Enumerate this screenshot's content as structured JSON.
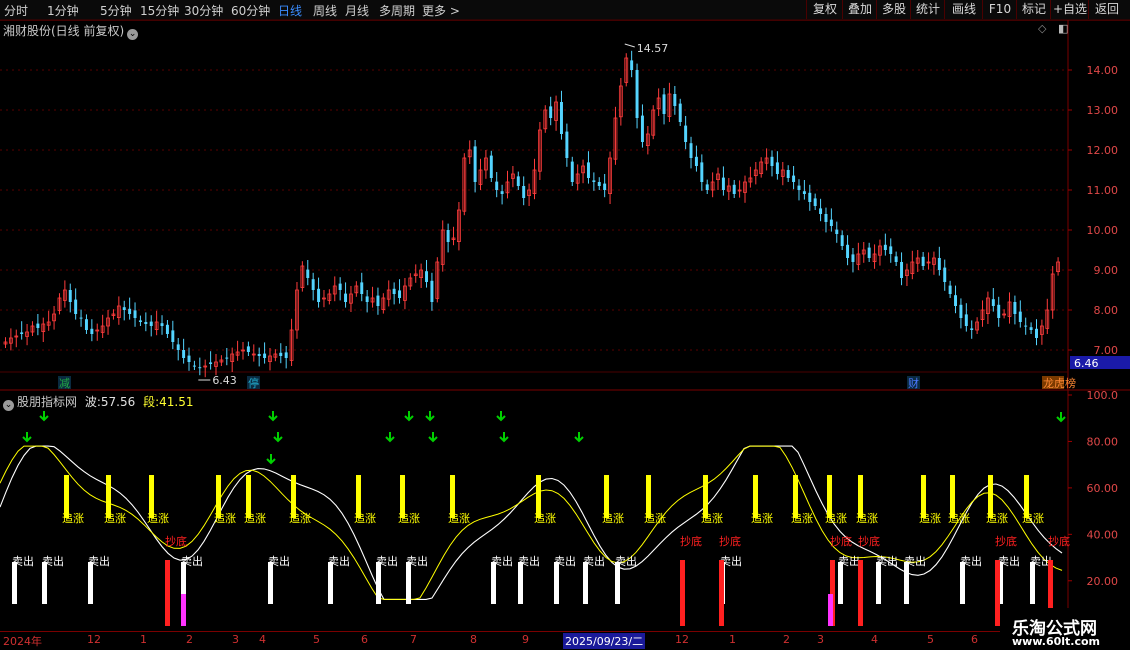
{
  "toolbar": {
    "periods": [
      "分时",
      "1分钟",
      "5分钟",
      "15分钟",
      "30分钟",
      "60分钟",
      "日线",
      "周线",
      "月线",
      "多周期",
      "更多 >"
    ],
    "active_period": "日线",
    "buttons": [
      "复权",
      "叠加",
      "多股",
      "统计",
      "画线",
      "F10",
      "标记",
      "+自选",
      "返回"
    ]
  },
  "main_chart": {
    "title": "湘财股份(日线 前复权)",
    "high_label": "14.57",
    "low_label": "6.43",
    "last_price": "6.46",
    "y_ticks": [
      "14.00",
      "13.00",
      "12.00",
      "11.00",
      "10.00",
      "9.00",
      "8.00",
      "7.00"
    ],
    "markers": [
      {
        "text": "减",
        "color": "#22aa44"
      },
      {
        "text": "停",
        "color": "#22aacc"
      },
      {
        "text": "财",
        "color": "#4a78ff"
      },
      {
        "text": "龙虎榜",
        "color": "#ff8833"
      }
    ]
  },
  "indicator": {
    "name": "股朋指标网",
    "wave_label": "波:",
    "wave_value": "57.56",
    "seg_label": "段:",
    "seg_value": "41.51",
    "y_ticks": [
      "100.0",
      "80.00",
      "60.00",
      "40.00",
      "20.00"
    ],
    "chase_label": "追涨",
    "bottom_label": "抄底",
    "sell_label": "卖出"
  },
  "date_axis": {
    "labels": [
      "2024年",
      "12",
      "1",
      "2",
      "3",
      "4",
      "5",
      "6",
      "7",
      "8",
      "9",
      "2025/09/23/二",
      "12",
      "1",
      "2",
      "3",
      "4",
      "5",
      "6"
    ]
  },
  "watermark": {
    "name": "乐淘公式网",
    "url": "www.60lt.com"
  },
  "colors": {
    "up": "#ff3c3c",
    "down": "#54d4ff",
    "grid": "#5a0000",
    "chase": "#ffff00",
    "sell": "#ffffff",
    "bottom": "#ff2020",
    "arrow": "#00d000",
    "magenta": "#ff33ff"
  },
  "chart_data": {
    "type": "candlestick",
    "y_range": [
      6.8,
      15.0
    ],
    "close": [
      7.2,
      7.3,
      7.35,
      7.4,
      7.45,
      7.6,
      7.55,
      7.65,
      7.7,
      7.9,
      8.3,
      8.5,
      8.2,
      7.9,
      7.8,
      7.5,
      7.4,
      7.5,
      7.6,
      7.8,
      7.9,
      8.1,
      8.0,
      7.9,
      7.8,
      7.7,
      7.65,
      7.6,
      7.7,
      7.6,
      7.4,
      7.2,
      7.0,
      6.8,
      6.7,
      6.6,
      6.55,
      6.6,
      6.65,
      6.7,
      6.75,
      6.8,
      6.9,
      6.95,
      7.0,
      6.95,
      6.9,
      6.85,
      6.8,
      6.85,
      6.9,
      6.85,
      6.8,
      7.5,
      8.5,
      9.1,
      8.8,
      8.5,
      8.2,
      8.3,
      8.4,
      8.6,
      8.5,
      8.2,
      8.4,
      8.6,
      8.4,
      8.2,
      8.3,
      8.1,
      8.3,
      8.5,
      8.4,
      8.3,
      8.6,
      8.8,
      8.9,
      9.0,
      8.7,
      8.2,
      9.2,
      10.0,
      9.7,
      9.8,
      10.5,
      11.8,
      12.0,
      11.2,
      11.5,
      11.8,
      11.3,
      11.0,
      10.9,
      11.2,
      11.4,
      11.1,
      10.8,
      11.0,
      11.5,
      12.5,
      13.0,
      12.8,
      13.2,
      12.4,
      11.8,
      11.2,
      11.4,
      11.6,
      11.3,
      11.2,
      11.1,
      11.0,
      11.8,
      12.8,
      13.6,
      14.3,
      14.0,
      12.8,
      12.2,
      12.4,
      13.0,
      13.3,
      12.9,
      13.4,
      13.1,
      12.7,
      12.2,
      11.8,
      11.6,
      11.2,
      11.0,
      11.2,
      11.4,
      11.0,
      11.1,
      10.9,
      11.0,
      11.2,
      11.3,
      11.5,
      11.7,
      11.8,
      11.6,
      11.4,
      11.5,
      11.3,
      11.2,
      11.0,
      10.9,
      10.7,
      10.6,
      10.4,
      10.2,
      10.1,
      9.9,
      9.6,
      9.3,
      9.2,
      9.4,
      9.5,
      9.3,
      9.4,
      9.6,
      9.5,
      9.4,
      9.2,
      8.8,
      9.0,
      9.2,
      9.3,
      9.1,
      9.2,
      9.3,
      9.0,
      8.7,
      8.4,
      8.1,
      7.8,
      7.6,
      7.5,
      7.7,
      8.0,
      8.3,
      8.1,
      7.8,
      7.9,
      8.2,
      7.9,
      7.7,
      7.6,
      7.5,
      7.3,
      7.6,
      8.0,
      8.9,
      9.2
    ]
  }
}
